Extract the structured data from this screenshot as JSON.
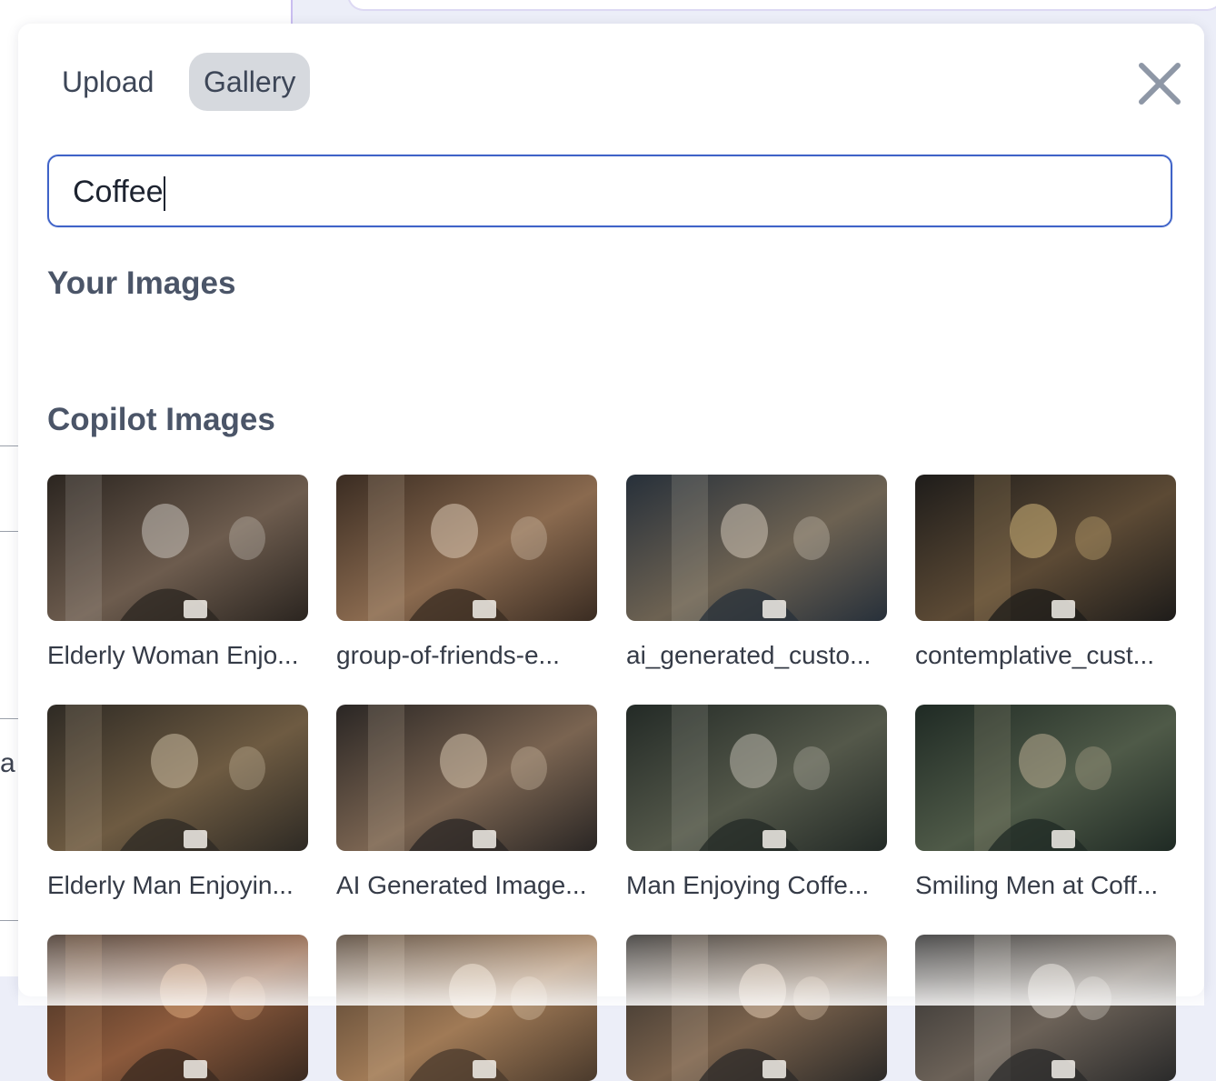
{
  "tabs": [
    {
      "label": "Upload",
      "active": false
    },
    {
      "label": "Gallery",
      "active": true
    }
  ],
  "close_icon": "close-icon",
  "search": {
    "value": "Coffee",
    "placeholder": ""
  },
  "sections": {
    "your_images": "Your Images",
    "copilot_images": "Copilot Images"
  },
  "background": {
    "fragment_text": "a"
  },
  "images": [
    {
      "caption": "Elderly Woman Enjo...",
      "palette": [
        "#2b2520",
        "#6d5c4e",
        "#c9c3bb"
      ]
    },
    {
      "caption": "group-of-friends-e...",
      "palette": [
        "#3a2c22",
        "#8a6a4f",
        "#d8c7b3"
      ]
    },
    {
      "caption": "ai_generated_custo...",
      "palette": [
        "#27303a",
        "#6d6252",
        "#cfc5b6"
      ]
    },
    {
      "caption": "contemplative_cust...",
      "palette": [
        "#1e1c1a",
        "#5c4a35",
        "#d0b47a"
      ]
    },
    {
      "caption": "Elderly Man Enjoyin...",
      "palette": [
        "#2e2a24",
        "#6e5b42",
        "#c9b9a0"
      ]
    },
    {
      "caption": "AI Generated Image...",
      "palette": [
        "#2a2624",
        "#7a6451",
        "#d3c2ad"
      ]
    },
    {
      "caption": "Man Enjoying Coffe...",
      "palette": [
        "#232a26",
        "#54584a",
        "#b9b7ac"
      ]
    },
    {
      "caption": "Smiling Men at Coff...",
      "palette": [
        "#1f2a24",
        "#4f5a48",
        "#b8ab92"
      ]
    },
    {
      "caption": "",
      "palette": [
        "#3a2a20",
        "#8c5a3c",
        "#d9a67a"
      ]
    },
    {
      "caption": "",
      "palette": [
        "#4a3a2c",
        "#a07a56",
        "#e3cdb4"
      ]
    },
    {
      "caption": "",
      "palette": [
        "#2c2a28",
        "#7a624c",
        "#e0c9b0"
      ]
    },
    {
      "caption": "",
      "palette": [
        "#2a2a2a",
        "#6c6258",
        "#d8d2c8"
      ]
    }
  ]
}
